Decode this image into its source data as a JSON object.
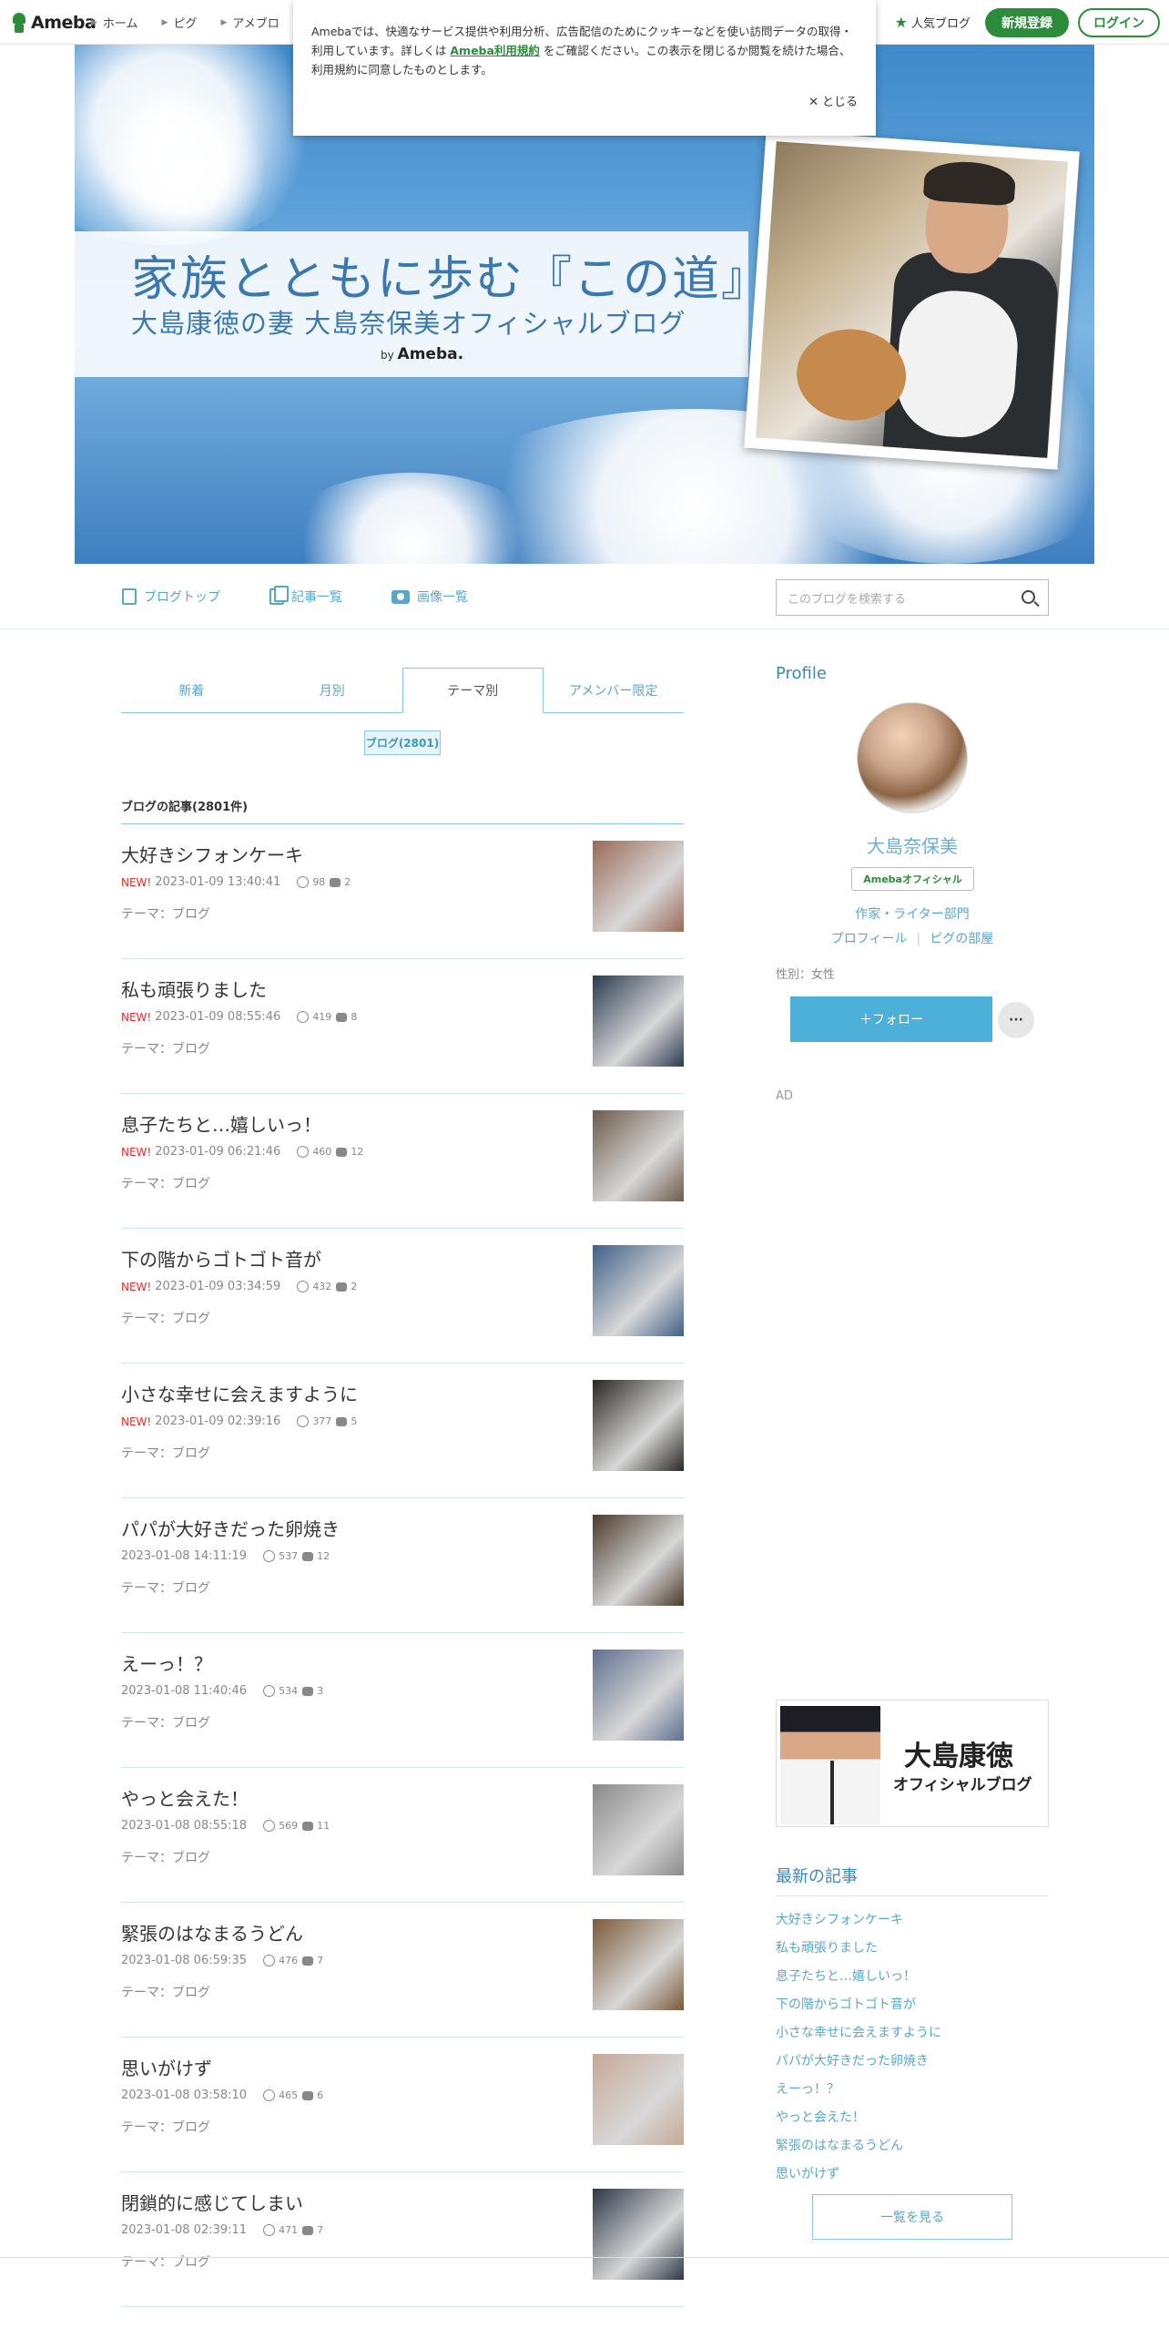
{
  "topbar": {
    "logo": "Ameba",
    "nav": [
      "ホーム",
      "ピグ",
      "アメブロ"
    ],
    "popular": "人気ブログ",
    "register": "新規登録",
    "login": "ログイン"
  },
  "cookie": {
    "text1": "Amebaでは、快適なサービス提供や利用分析、広告配信のためにクッキーなどを使い訪問データの取得・利用しています。詳しくは",
    "link": "Ameba利用規約",
    "text2": "をご確認ください。この表示を閉じるか閲覧を続けた場合、利用規約に同意したものとします。",
    "close": "とじる"
  },
  "header": {
    "title": "家族とともに歩む『この道』",
    "subtitle": "大島康徳の妻 大島奈保美オフィシャルブログ",
    "by": "by",
    "ameba": "Ameba."
  },
  "subnav": {
    "items": [
      "ブログトップ",
      "記事一覧",
      "画像一覧"
    ],
    "search_placeholder": "このブログを検索する"
  },
  "tabs": [
    "新着",
    "月別",
    "テーマ別",
    "アメンバー限定"
  ],
  "theme_badge": "ブログ(2801)",
  "list_heading": "ブログの記事(2801件)",
  "entries": [
    {
      "title": "大好きシフォンケーキ",
      "new": "NEW!",
      "date": "2023-01-09 13:40:41",
      "likes": "98",
      "comments": "2",
      "theme": "テーマ：ブログ"
    },
    {
      "title": "私も頑張りました",
      "new": "NEW!",
      "date": "2023-01-09 08:55:46",
      "likes": "419",
      "comments": "8",
      "theme": "テーマ：ブログ"
    },
    {
      "title": "息子たちと…嬉しいっ！",
      "new": "NEW!",
      "date": "2023-01-09 06:21:46",
      "likes": "460",
      "comments": "12",
      "theme": "テーマ：ブログ"
    },
    {
      "title": "下の階からゴトゴト音が",
      "new": "NEW!",
      "date": "2023-01-09 03:34:59",
      "likes": "432",
      "comments": "2",
      "theme": "テーマ：ブログ"
    },
    {
      "title": "小さな幸せに会えますように",
      "new": "NEW!",
      "date": "2023-01-09 02:39:16",
      "likes": "377",
      "comments": "5",
      "theme": "テーマ：ブログ"
    },
    {
      "title": "パパが大好きだった卵焼き",
      "new": "",
      "date": "2023-01-08 14:11:19",
      "likes": "537",
      "comments": "12",
      "theme": "テーマ：ブログ"
    },
    {
      "title": "えーっ！？",
      "new": "",
      "date": "2023-01-08 11:40:46",
      "likes": "534",
      "comments": "3",
      "theme": "テーマ：ブログ"
    },
    {
      "title": "やっと会えた！",
      "new": "",
      "date": "2023-01-08 08:55:18",
      "likes": "569",
      "comments": "11",
      "theme": "テーマ：ブログ"
    },
    {
      "title": "緊張のはなまるうどん",
      "new": "",
      "date": "2023-01-08 06:59:35",
      "likes": "476",
      "comments": "7",
      "theme": "テーマ：ブログ"
    },
    {
      "title": "思いがけず",
      "new": "",
      "date": "2023-01-08 03:58:10",
      "likes": "465",
      "comments": "6",
      "theme": "テーマ：ブログ"
    },
    {
      "title": "閉鎖的に感じてしまい",
      "new": "",
      "date": "2023-01-08 02:39:11",
      "likes": "471",
      "comments": "7",
      "theme": "テーマ：ブログ"
    }
  ],
  "thumb_colors": [
    "#9a6a58",
    "#2b3a50",
    "#6b5a4a",
    "#3f5f86",
    "#2a2622",
    "#4a3a2c",
    "#5e6f8f",
    "#8a8a8a",
    "#7a5a3a",
    "#c6a896",
    "#2c3846"
  ],
  "profile": {
    "heading": "Profile",
    "name": "大島奈保美",
    "badge": "Amebaオフィシャル",
    "category": "作家・ライター部門",
    "link_profile": "プロフィール",
    "link_room": "ピグの部屋",
    "gender": "性別：女性",
    "follow": "＋フォロー",
    "more": "···",
    "ad": "AD"
  },
  "banner": {
    "name": "大島康徳",
    "sub": "オフィシャルブログ"
  },
  "latest": {
    "heading": "最新の記事",
    "items": [
      "大好きシフォンケーキ",
      "私も頑張りました",
      "息子たちと…嬉しいっ！",
      "下の階からゴトゴト音が",
      "小さな幸せに会えますように",
      "パパが大好きだった卵焼き",
      "えーっ！？",
      "やっと会えた！",
      "緊張のはなまるうどん",
      "思いがけず"
    ],
    "see_all": "一覧を見る"
  }
}
